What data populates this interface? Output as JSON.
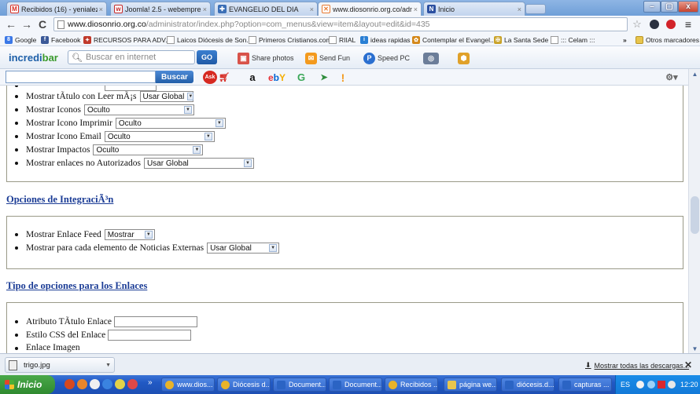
{
  "tabs": [
    {
      "title": "Recibidos (16) - yenialeza@g",
      "icon": "gmail-icon",
      "color": "#d93025",
      "glyph": "M"
    },
    {
      "title": "Joomla! 2.5 - webempresa jo",
      "icon": "webempresa-icon",
      "color": "#c62828",
      "glyph": "w"
    },
    {
      "title": "EVANGELIO DEL DIA",
      "icon": "evangelio-icon",
      "color": "#3b6fb6",
      "glyph": "✚"
    },
    {
      "title": "www.diosonrio.org.co/admin",
      "icon": "joomla-icon",
      "color": "#e8792f",
      "glyph": "✕"
    },
    {
      "title": "Inicio",
      "icon": "inicio-icon",
      "color": "#2b4fa0",
      "glyph": "N"
    }
  ],
  "window_controls": {
    "minimize": "–",
    "restore": "▢",
    "close": "x"
  },
  "nav": {
    "url_host": "www.diosonrio.org.co",
    "url_path": "/administrator/index.php?option=com_menus&view=item&layout=edit&id=435"
  },
  "bookmarks": [
    {
      "label": "Google",
      "icon": "google-icon",
      "color": "#3b78e7",
      "glyph": "8"
    },
    {
      "label": "Facebook",
      "icon": "facebook-icon",
      "color": "#3b5998",
      "glyph": "f"
    },
    {
      "label": "RECURSOS PARA ADV...",
      "icon": "recursos-icon",
      "color": "#c0392b",
      "glyph": "✦"
    },
    {
      "label": "Laicos Diócesis de Son...",
      "icon": "page-icon",
      "color": "",
      "glyph": ""
    },
    {
      "label": "Primeros Cristianos.com",
      "icon": "page-icon",
      "color": "",
      "glyph": ""
    },
    {
      "label": "RIIAL",
      "icon": "page-icon",
      "color": "",
      "glyph": ""
    },
    {
      "label": "ideas rapidas",
      "icon": "ideas-icon",
      "color": "#2a7fd4",
      "glyph": "i"
    },
    {
      "label": "Contemplar el Evangel...",
      "icon": "contemplar-icon",
      "color": "#d4881a",
      "glyph": "✿"
    },
    {
      "label": "La Santa Sede",
      "icon": "santasede-icon",
      "color": "#c9a227",
      "glyph": "✠"
    },
    {
      "label": "::: Celam :::",
      "icon": "page-icon",
      "color": "",
      "glyph": ""
    }
  ],
  "bookmarks_overflow": "»",
  "other_bookmarks": "Otros marcadores",
  "incredibar": {
    "logo_a": "incredi",
    "logo_b": "bar",
    "search_placeholder": "Buscar en internet",
    "go": "GO",
    "items": [
      {
        "label": "Share photos",
        "icon": "share-photos-icon",
        "color": "#d8534a",
        "glyph": "▣"
      },
      {
        "label": "Send Fun",
        "icon": "send-fun-icon",
        "color": "#f39a1e",
        "glyph": "✉"
      },
      {
        "label": "Speed PC",
        "icon": "speed-pc-icon",
        "color": "#2a6fd0",
        "glyph": "P"
      }
    ]
  },
  "searchbar": {
    "button": "Buscar"
  },
  "section1": {
    "options": [
      {
        "label": "Mostrar tÃtulo con Leer mÃ¡s",
        "value": "Usar Global"
      },
      {
        "label": "Mostrar Iconos",
        "value": "Oculto"
      },
      {
        "label": "Mostrar Icono Imprimir",
        "value": "Oculto"
      },
      {
        "label": "Mostrar Icono Email",
        "value": "Oculto"
      },
      {
        "label": "Mostrar Impactos",
        "value": "Oculto"
      },
      {
        "label": "Mostrar enlaces no Autorizados",
        "value": "Usar Global"
      }
    ]
  },
  "section2": {
    "title": "Opciones de IntegraciÃ³n",
    "options": [
      {
        "label": "Mostrar Enlace Feed",
        "value": "Mostrar"
      },
      {
        "label": "Mostrar para cada elemento de Noticias Externas",
        "value": "Usar Global"
      }
    ]
  },
  "section3": {
    "title": "Tipo de opciones para los Enlaces",
    "options": [
      {
        "label": "Atributo TÃtulo Enlace",
        "value": ""
      },
      {
        "label": "Estilo CSS del Enlace",
        "value": ""
      },
      {
        "label": "Enlace Imagen",
        "value": ""
      }
    ]
  },
  "downloads": {
    "file": "trigo.jpg",
    "show_all": "Mostrar todas las descargas...",
    "close": "✕"
  },
  "taskbar": {
    "start": "Inicio",
    "tasks": [
      {
        "label": "www.dios...",
        "icon": "chrome-icon",
        "color": "#e8b32a"
      },
      {
        "label": "Diócesis d...",
        "icon": "chrome-icon",
        "color": "#e8b32a"
      },
      {
        "label": "Document...",
        "icon": "word-icon",
        "color": "#2b64c4"
      },
      {
        "label": "Document...",
        "icon": "word-icon",
        "color": "#2b64c4"
      },
      {
        "label": "Recibidos ...",
        "icon": "chrome-icon",
        "color": "#e8b32a"
      },
      {
        "label": "página we...",
        "icon": "folder-icon",
        "color": "#e8c54d"
      },
      {
        "label": "diócesis.d...",
        "icon": "word-icon",
        "color": "#2b64c4"
      },
      {
        "label": "capturas ...",
        "icon": "word-icon",
        "color": "#2b64c4"
      }
    ],
    "lang": "ES",
    "time": "12:20"
  }
}
